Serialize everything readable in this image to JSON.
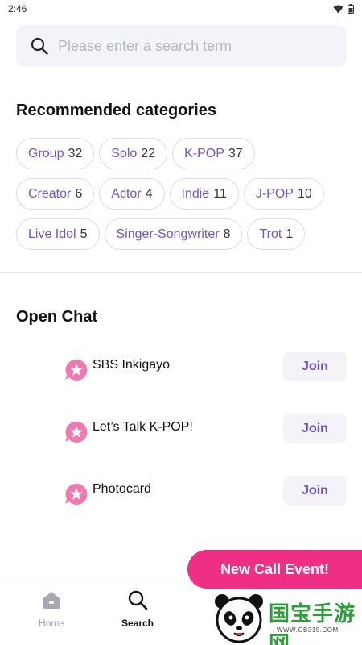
{
  "status": {
    "time": "2:46"
  },
  "search": {
    "placeholder": "Please enter a search term"
  },
  "categories": {
    "title": "Recommended categories",
    "rows": [
      [
        {
          "name": "Group",
          "count": "32"
        },
        {
          "name": "Solo",
          "count": "22"
        },
        {
          "name": "K-POP",
          "count": "37"
        }
      ],
      [
        {
          "name": "Creator",
          "count": "6"
        },
        {
          "name": "Actor",
          "count": "4"
        },
        {
          "name": "Indie",
          "count": "11"
        },
        {
          "name": "J-POP",
          "count": "10"
        }
      ],
      [
        {
          "name": "Live Idol",
          "count": "5"
        },
        {
          "name": "Singer-Songwriter",
          "count": "8"
        },
        {
          "name": "Trot",
          "count": "1"
        }
      ]
    ]
  },
  "open_chat": {
    "title": "Open Chat",
    "items": [
      {
        "name": "SBS Inkigayo",
        "join_label": "Join"
      },
      {
        "name": "Let’s Talk K-POP!",
        "join_label": "Join"
      },
      {
        "name": "Photocard",
        "join_label": "Join"
      }
    ]
  },
  "event_button": {
    "label": "New Call Event!"
  },
  "nav": {
    "home": "Home",
    "search": "Search"
  },
  "watermark": {
    "text": "国宝手游网",
    "url": "- WWW.GB315.COM -"
  },
  "colors": {
    "accent_purple": "#7055c9",
    "event_pink": "#ef2f86",
    "chat_icon_pink": "#f07ab0"
  }
}
